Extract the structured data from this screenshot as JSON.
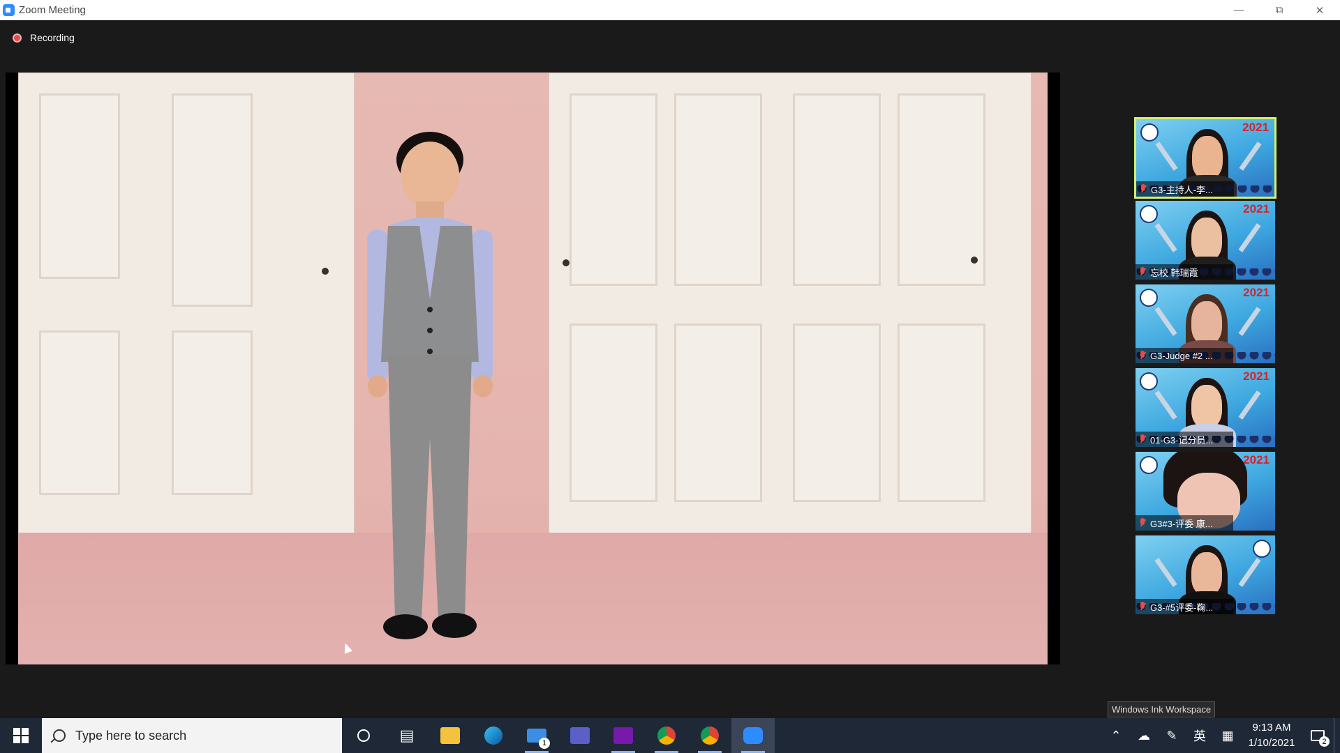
{
  "window": {
    "title": "Zoom Meeting",
    "minimize_icon": "minimize-icon",
    "restore_icon": "restore-icon",
    "close_icon": "close-icon"
  },
  "recording": {
    "label": "Recording",
    "color": "#e24d4d"
  },
  "participants": [
    {
      "name": "G3-主持人-李...",
      "active": true
    },
    {
      "name": "忘校 韩瑞霞",
      "active": false
    },
    {
      "name": "G3-Judge #2 ...",
      "active": false
    },
    {
      "name": "01-G3-记分员...",
      "active": false
    },
    {
      "name": "G3#3-评委 康...",
      "active": false
    },
    {
      "name": "G3-#5评委-鞠...",
      "active": false
    }
  ],
  "thumbnail_year": "2021",
  "tooltip": "Windows Ink Workspace",
  "taskbar": {
    "search_placeholder": "Type here to search",
    "mail_badge": "1",
    "time": "9:13 AM",
    "date": "1/10/2021",
    "ime": "英",
    "notifications": "2"
  },
  "colors": {
    "active_border": "#d3f06a",
    "zoom_blue": "#2d8cff",
    "taskbar": "#1f2836"
  }
}
